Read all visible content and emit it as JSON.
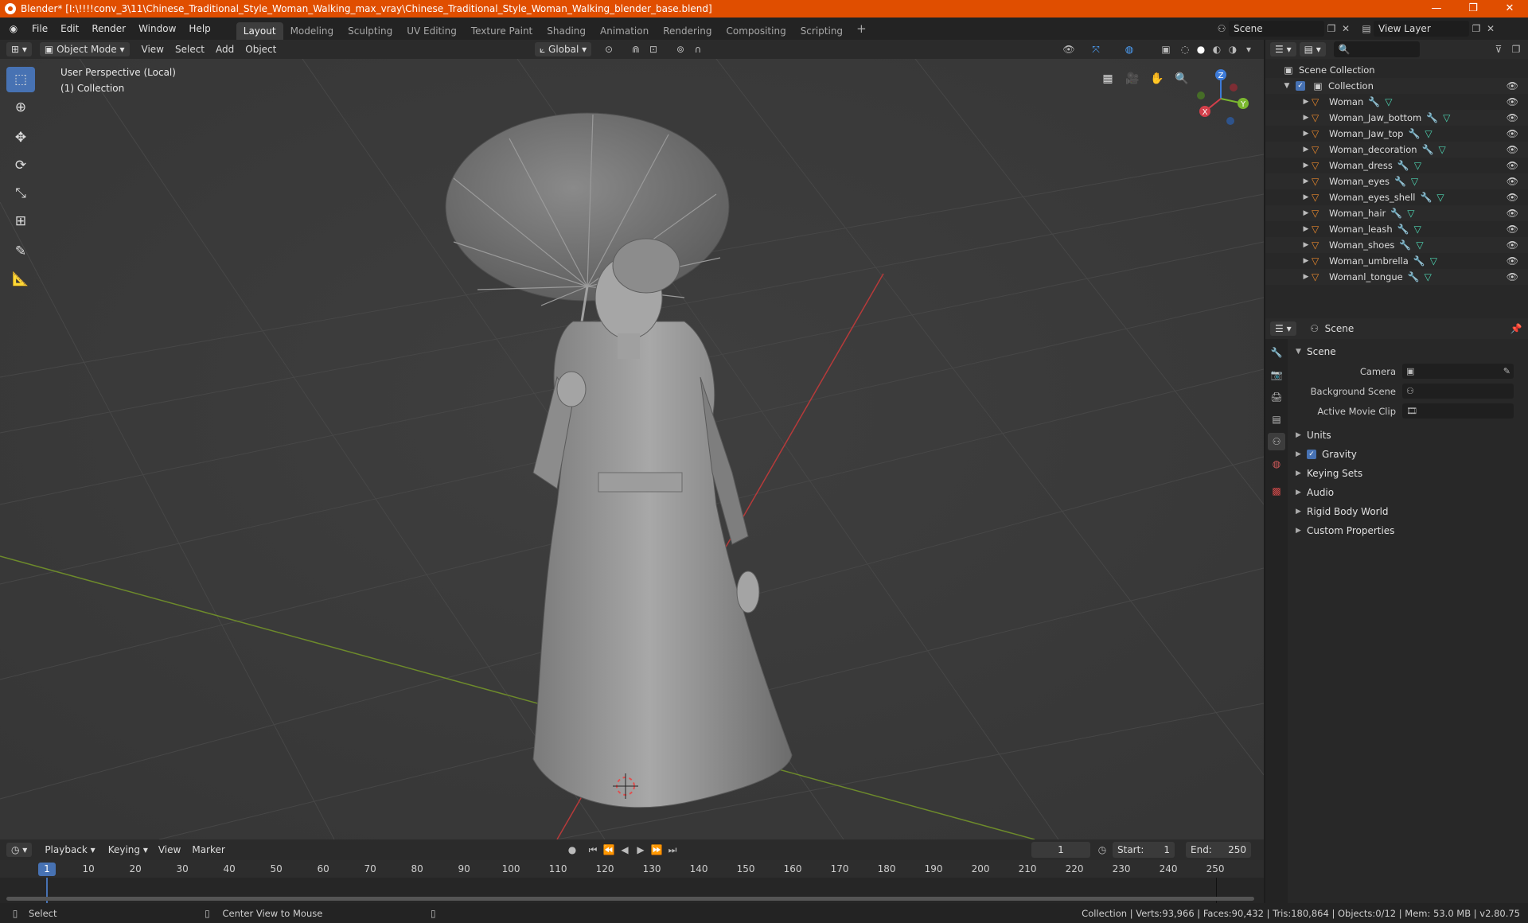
{
  "window": {
    "title": "Blender* [I:\\!!!!conv_3\\11\\Chinese_Traditional_Style_Woman_Walking_max_vray\\Chinese_Traditional_Style_Woman_Walking_blender_base.blend]",
    "controls": [
      "—",
      "❐",
      "✕"
    ]
  },
  "menu": [
    "File",
    "Edit",
    "Render",
    "Window",
    "Help"
  ],
  "workspaces": [
    {
      "label": "Layout",
      "active": true
    },
    {
      "label": "Modeling"
    },
    {
      "label": "Sculpting"
    },
    {
      "label": "UV Editing"
    },
    {
      "label": "Texture Paint"
    },
    {
      "label": "Shading"
    },
    {
      "label": "Animation"
    },
    {
      "label": "Rendering"
    },
    {
      "label": "Compositing"
    },
    {
      "label": "Scripting"
    }
  ],
  "scene_selector": "Scene",
  "view_layer": "View Layer",
  "viewport_header": {
    "mode": "Object Mode",
    "menus": [
      "View",
      "Select",
      "Add",
      "Object"
    ],
    "orientation": "Global"
  },
  "viewport": {
    "perspective": "User Perspective (Local)",
    "collection": "(1) Collection",
    "gizmo": {
      "z": "Z",
      "y": "Y",
      "x": "X"
    }
  },
  "outliner": {
    "root": "Scene Collection",
    "collection": "Collection",
    "objects": [
      "Woman",
      "Woman_Jaw_bottom",
      "Woman_Jaw_top",
      "Woman_decoration",
      "Woman_dress",
      "Woman_eyes",
      "Woman_eyes_shell",
      "Woman_hair",
      "Woman_leash",
      "Woman_shoes",
      "Woman_umbrella",
      "Womanl_tongue"
    ]
  },
  "properties": {
    "header": "Scene",
    "panel": "Scene",
    "fields": [
      {
        "label": "Camera"
      },
      {
        "label": "Background Scene"
      },
      {
        "label": "Active Movie Clip"
      }
    ],
    "sections": [
      "Units",
      "Gravity",
      "Keying Sets",
      "Audio",
      "Rigid Body World",
      "Custom Properties"
    ],
    "gravity_checked": true
  },
  "timeline": {
    "menus": [
      "Playback",
      "Keying",
      "View",
      "Marker"
    ],
    "current_frame": "1",
    "start_label": "Start:",
    "start": "1",
    "end_label": "End:",
    "end": "250",
    "ticks": [
      "10",
      "20",
      "30",
      "40",
      "50",
      "60",
      "70",
      "80",
      "90",
      "100",
      "110",
      "120",
      "130",
      "140",
      "150",
      "160",
      "170",
      "180",
      "190",
      "200",
      "210",
      "220",
      "230",
      "240",
      "250"
    ]
  },
  "status": {
    "left_action": "Select",
    "middle_action": "Center View to Mouse",
    "stats": "Collection | Verts:93,966 | Faces:90,432 | Tris:180,864 | Objects:0/12 | Mem: 53.0 MB | v2.80.75"
  }
}
